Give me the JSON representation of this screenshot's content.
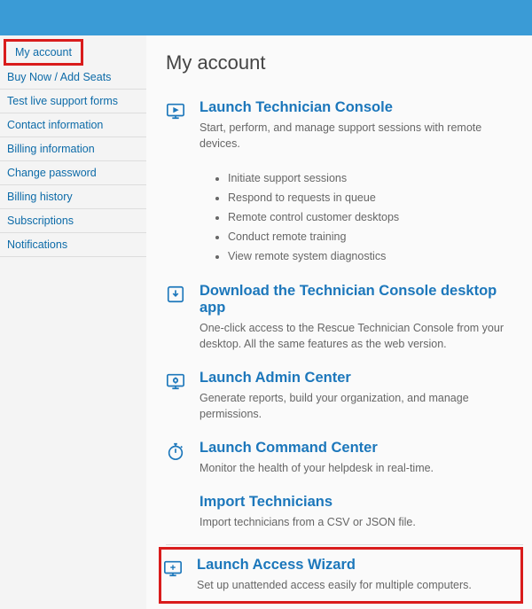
{
  "header": {
    "title": "My account"
  },
  "sidebar": {
    "items": [
      {
        "label": "My account"
      },
      {
        "label": "Buy Now / Add Seats"
      },
      {
        "label": "Test live support forms"
      },
      {
        "label": "Contact information"
      },
      {
        "label": "Billing information"
      },
      {
        "label": "Change password"
      },
      {
        "label": "Billing history"
      },
      {
        "label": "Subscriptions"
      },
      {
        "label": "Notifications"
      }
    ]
  },
  "main": {
    "features": [
      {
        "icon": "monitor-play-icon",
        "title": "Launch Technician Console",
        "desc": "Start, perform, and manage support sessions with remote devices.",
        "bullets": [
          "Initiate support sessions",
          "Respond to requests in queue",
          "Remote control customer desktops",
          "Conduct remote training",
          "View remote system diagnostics"
        ]
      },
      {
        "icon": "download-icon",
        "title": "Download the Technician Console desktop app",
        "desc": "One-click access to the Rescue Technician Console from your desktop. All the same features as the web version."
      },
      {
        "icon": "gear-monitor-icon",
        "title": "Launch Admin Center",
        "desc": "Generate reports, build your organization, and manage permissions."
      },
      {
        "icon": "stopwatch-icon",
        "title": "Launch Command Center",
        "desc": "Monitor the health of your helpdesk in real-time."
      },
      {
        "icon": "import-icon",
        "title": "Import Technicians",
        "desc": "Import technicians from a CSV or JSON file."
      },
      {
        "icon": "monitor-wizard-icon",
        "title": "Launch Access Wizard",
        "desc": "Set up unattended access easily for multiple computers."
      }
    ]
  }
}
